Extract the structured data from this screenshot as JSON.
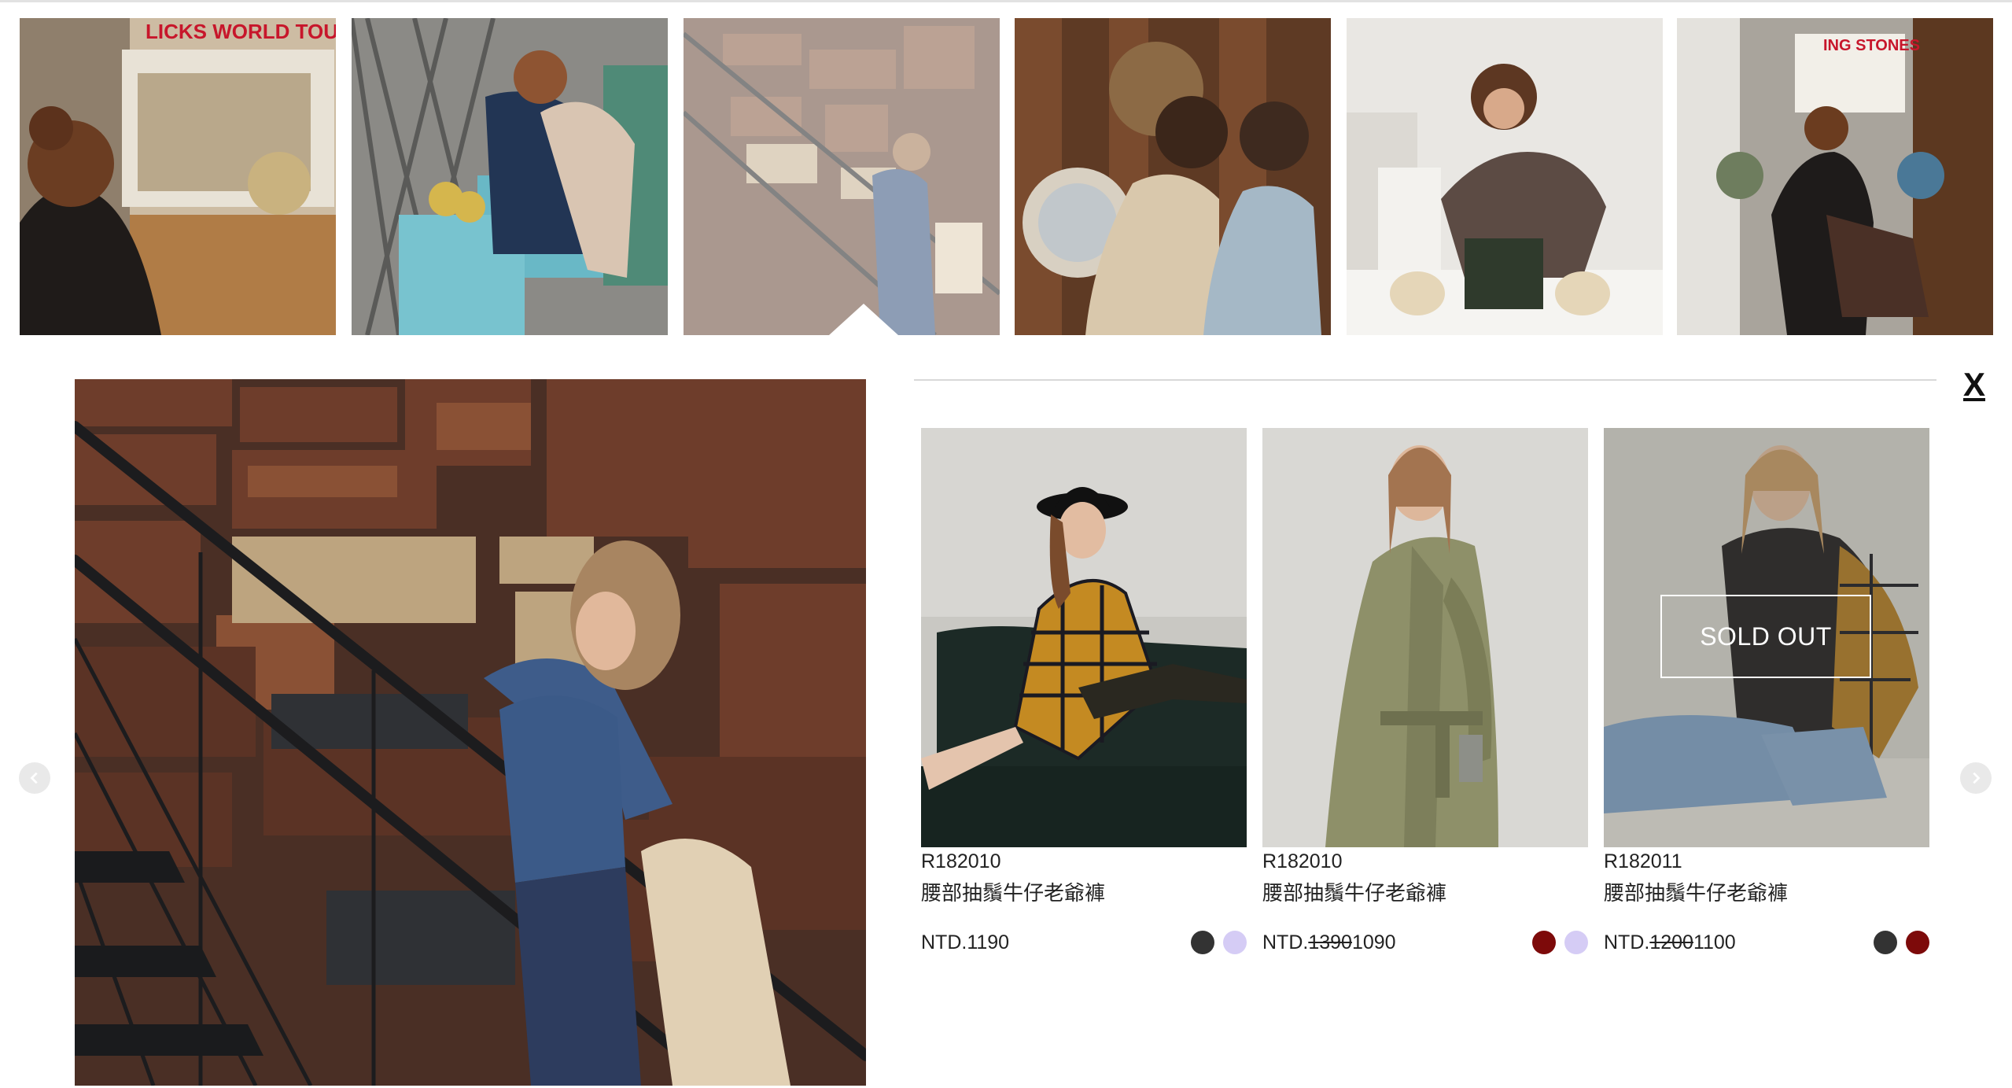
{
  "thumbnails": [
    {
      "alt": "photo-1",
      "sign": "LICKS WORLD TOUR"
    },
    {
      "alt": "photo-2"
    },
    {
      "alt": "photo-3"
    },
    {
      "alt": "photo-4"
    },
    {
      "alt": "photo-5"
    },
    {
      "alt": "photo-6",
      "sign": "ING STONES"
    }
  ],
  "panel": {
    "close_label": "X"
  },
  "products": [
    {
      "code": "R182010",
      "name": "腰部抽鬚牛仔老爺褲",
      "price_prefix": "NTD.",
      "original_price": "",
      "price": "1190",
      "sold_out": false,
      "swatches": [
        "#333333",
        "#d5ccf5"
      ]
    },
    {
      "code": "R182010",
      "name": "腰部抽鬚牛仔老爺褲",
      "price_prefix": "NTD.",
      "original_price": "1390",
      "price": "1090",
      "sold_out": false,
      "swatches": [
        "#7d0a0a",
        "#d5ccf5"
      ]
    },
    {
      "code": "R182011",
      "name": "腰部抽鬚牛仔老爺褲",
      "price_prefix": "NTD.",
      "original_price": "1200",
      "price": "1100",
      "sold_out": true,
      "sold_out_label": "SOLD OUT",
      "swatches": [
        "#333333",
        "#7d0a0a"
      ]
    }
  ],
  "icons": {
    "prev": "chevron-left-icon",
    "next": "chevron-right-icon"
  }
}
